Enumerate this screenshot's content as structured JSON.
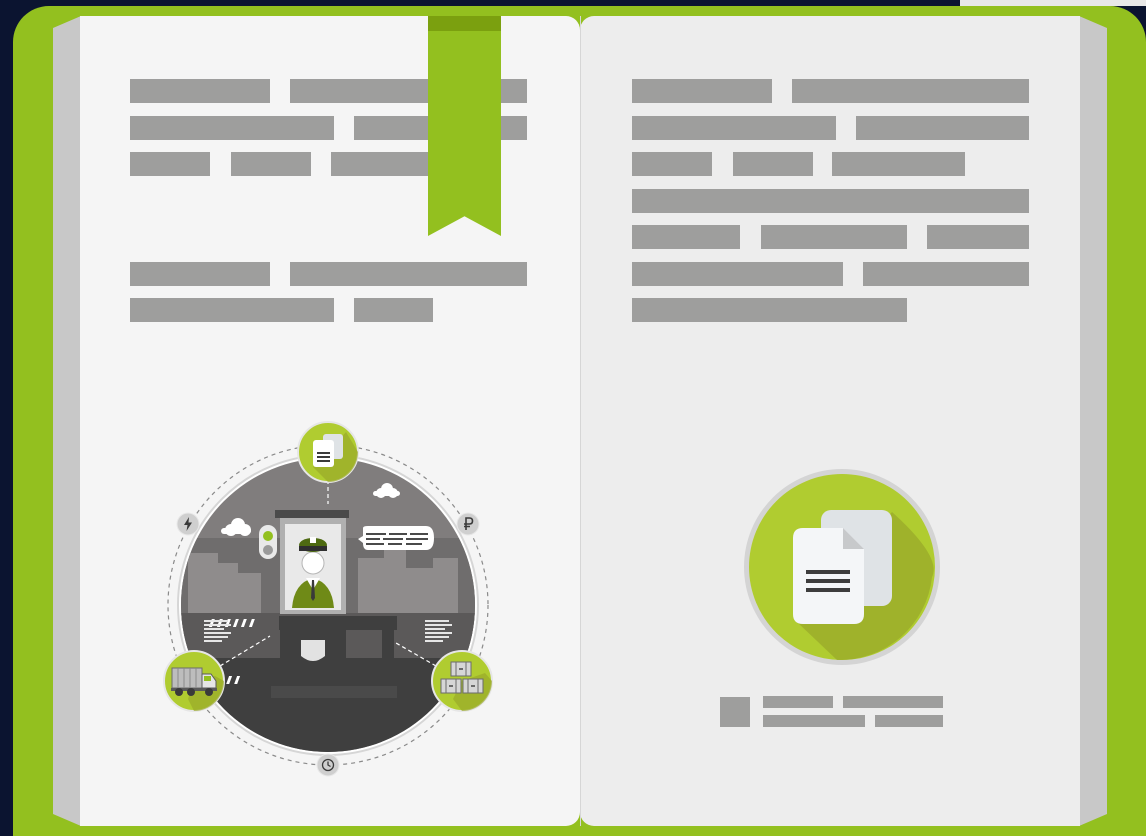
{
  "colors": {
    "accent_green": "#93c01f",
    "dark_green": "#7ba00f",
    "light_green": "#b0cc30",
    "text_placeholder_grey": "#9e9e9d",
    "background_navy": "#0b1430"
  },
  "icons": {
    "bookmark": "bookmark-ribbon",
    "center_top": "document-icon",
    "left_bottom": "truck-icon",
    "right_bottom": "containers-icon",
    "bottom_small": "clock-icon",
    "left_small": "lightning-icon",
    "right_small": "ruble-icon",
    "right_page": "documents-copy-icon"
  }
}
